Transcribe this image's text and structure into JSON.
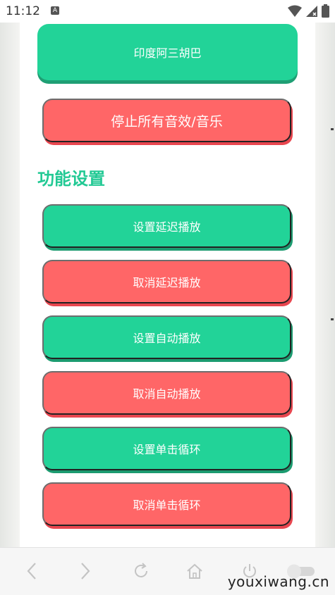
{
  "status": {
    "time": "11:12",
    "notification_badge": "A"
  },
  "buttons": {
    "top": "印度阿三胡巴",
    "stop_all": "停止所有音效/音乐",
    "set_delay": "设置延迟播放",
    "cancel_delay": "取消延迟播放",
    "set_auto": "设置自动播放",
    "cancel_auto": "取消自动播放",
    "set_loop": "设置单击循环",
    "cancel_loop": "取消单击循环"
  },
  "section": {
    "title": "功能设置"
  },
  "watermark": "youxiwang.cn",
  "colors": {
    "green": "#22d398",
    "red": "#ff6667",
    "title_green": "#22c994"
  },
  "icons": {
    "nav": [
      "back-arrow-icon",
      "forward-arrow-icon",
      "refresh-icon",
      "home-icon",
      "power-icon",
      "toggle-icon"
    ],
    "status": [
      "wifi-icon",
      "signal-icon",
      "battery-icon"
    ]
  }
}
